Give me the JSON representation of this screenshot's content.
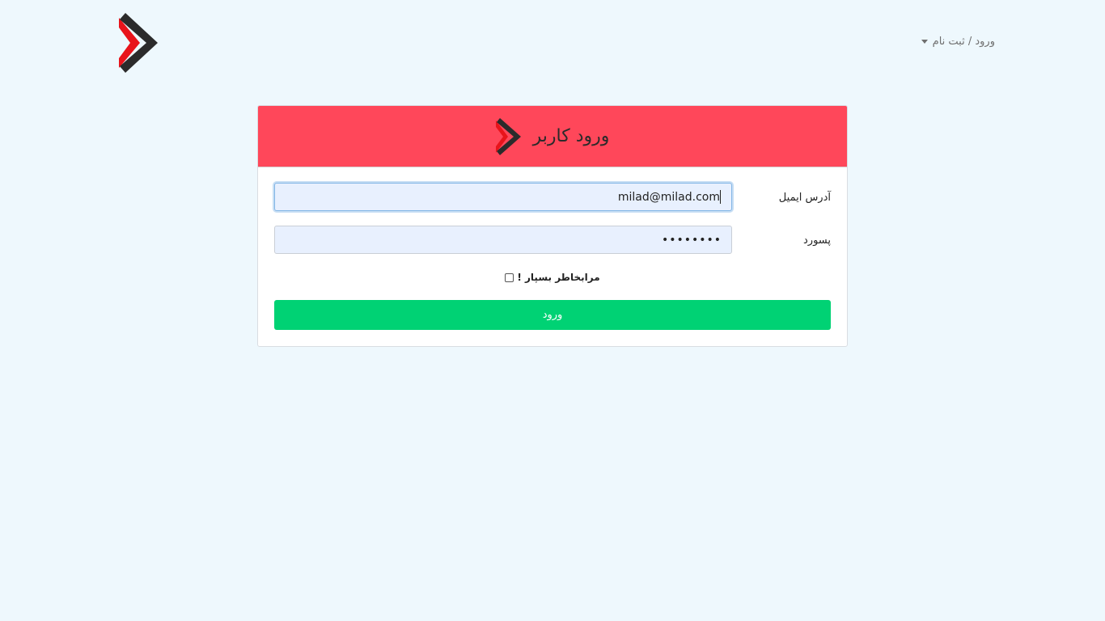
{
  "nav": {
    "menu_label": "ورود / ثبت نام"
  },
  "login": {
    "title": "ورود کاربر",
    "email_label": "آدرس ایمیل",
    "email_value": "milad@milad.com",
    "password_label": "پسورد",
    "password_value": "••••••••",
    "remember_label": "مرابخاطر بسپار !",
    "remember_checked": false,
    "submit_label": "ورود"
  },
  "colors": {
    "page_bg": "#eef8fd",
    "header_bg": "#ff475a",
    "submit_bg": "#00d274",
    "input_bg": "#e8f0fe",
    "logo_red": "#e8141b",
    "logo_dark": "#2b2b2b"
  },
  "icons": {
    "brand": "double-chevron-logo",
    "menu": "caret-down-icon"
  }
}
